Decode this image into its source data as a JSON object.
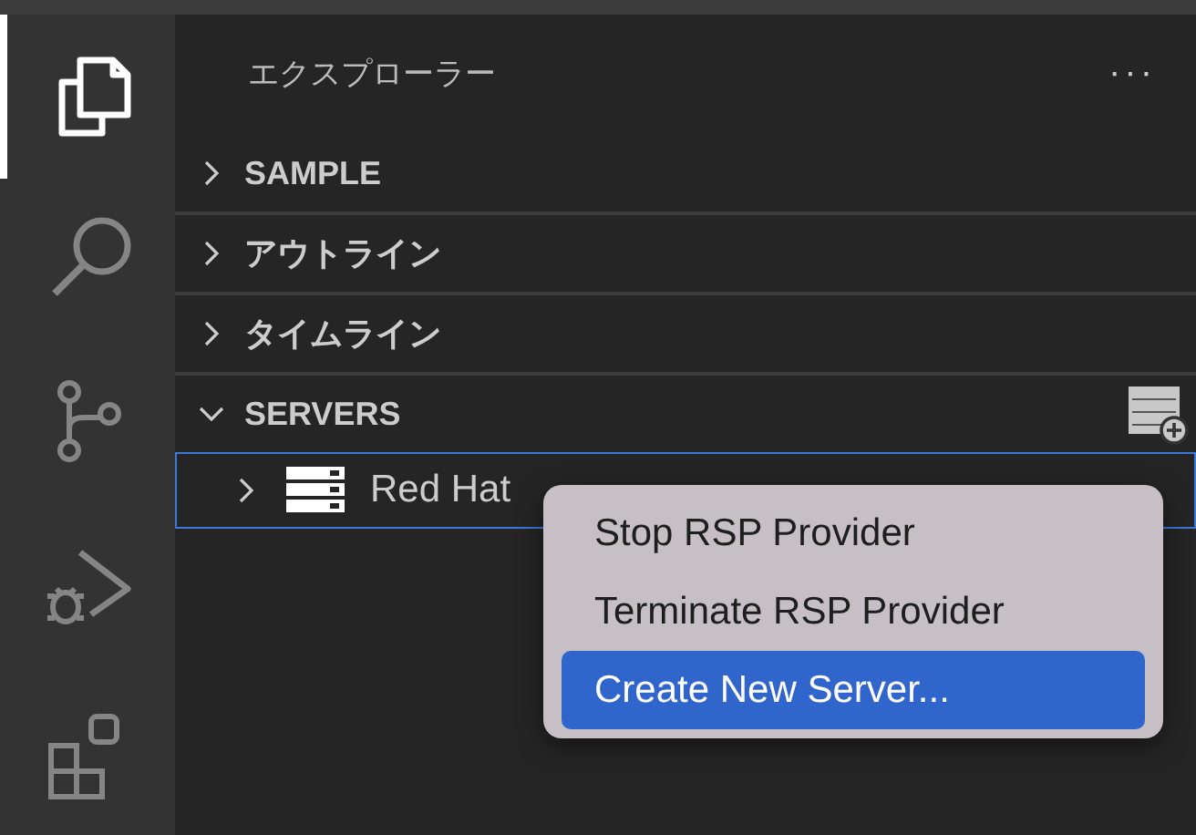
{
  "activity_bar": [
    {
      "kind": "files",
      "selected": true
    },
    {
      "kind": "search",
      "selected": false
    },
    {
      "kind": "source-control",
      "selected": false
    },
    {
      "kind": "run-debug",
      "selected": false
    },
    {
      "kind": "extensions",
      "selected": false
    }
  ],
  "sidebar": {
    "title": "エクスプローラー",
    "more": "···",
    "sections": [
      {
        "label": "SAMPLE",
        "expanded": false
      },
      {
        "label": "アウトライン",
        "expanded": false
      },
      {
        "label": "タイムライン",
        "expanded": false
      },
      {
        "label": "SERVERS",
        "expanded": true,
        "add_button": true
      }
    ],
    "tree_items": [
      {
        "label": "Red Hat",
        "expanded": false,
        "selected": true
      }
    ]
  },
  "context_menu": [
    {
      "label": "Stop RSP Provider",
      "selected": false
    },
    {
      "label": "Terminate RSP Provider",
      "selected": false
    },
    {
      "label": "Create New Server...",
      "selected": true
    }
  ]
}
